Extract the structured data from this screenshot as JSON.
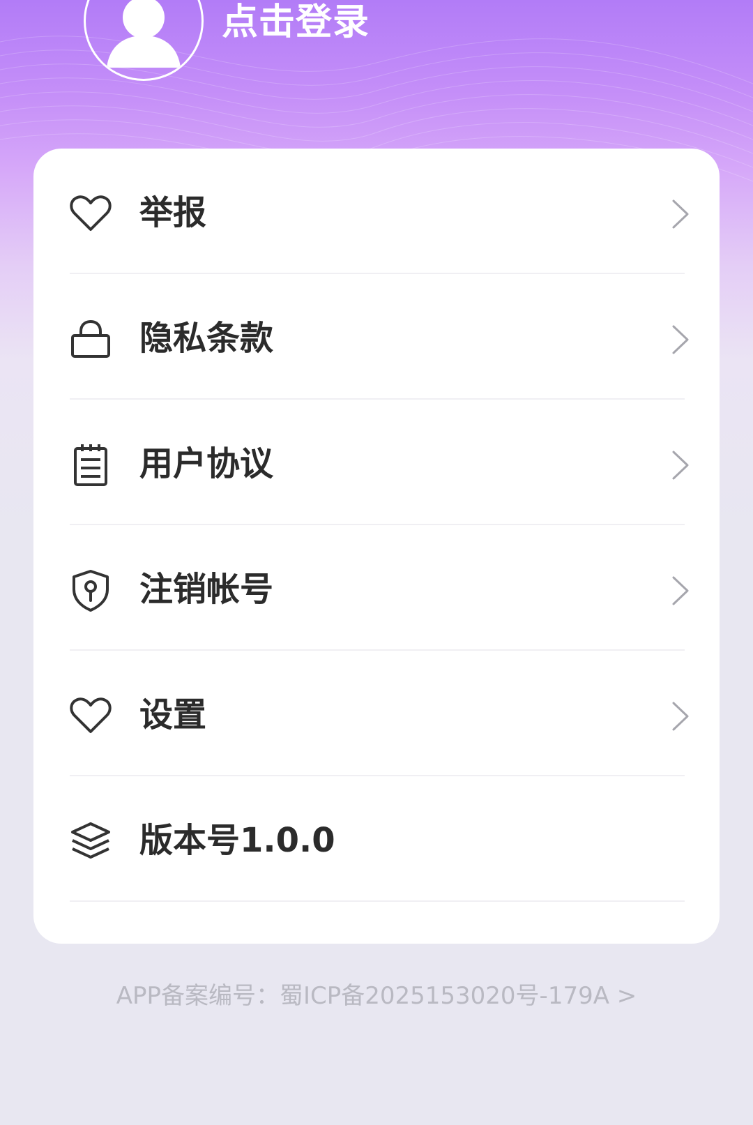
{
  "header": {
    "login_label": "点击登录",
    "avatar_icon": "user-avatar-icon"
  },
  "menu": {
    "items": [
      {
        "label": "举报",
        "icon": "heart-icon",
        "has_chevron": true
      },
      {
        "label": "隐私条款",
        "icon": "lock-icon",
        "has_chevron": true
      },
      {
        "label": "用户协议",
        "icon": "notepad-icon",
        "has_chevron": true
      },
      {
        "label": "注销帐号",
        "icon": "shield-keyhole-icon",
        "has_chevron": true
      },
      {
        "label": "设置",
        "icon": "heart-icon",
        "has_chevron": true
      },
      {
        "label": "版本号1.0.0",
        "icon": "layers-icon",
        "has_chevron": false
      }
    ]
  },
  "footer": {
    "icp_text": "APP备案编号：蜀ICP备2025153020号-179A >"
  },
  "colors": {
    "gradient_top": "#b27cf7",
    "background": "#e8e7f1",
    "card": "#ffffff",
    "label_text": "#2b2b2b",
    "chevron": "#a6a6ad",
    "footer_text": "#b9b9c2"
  }
}
